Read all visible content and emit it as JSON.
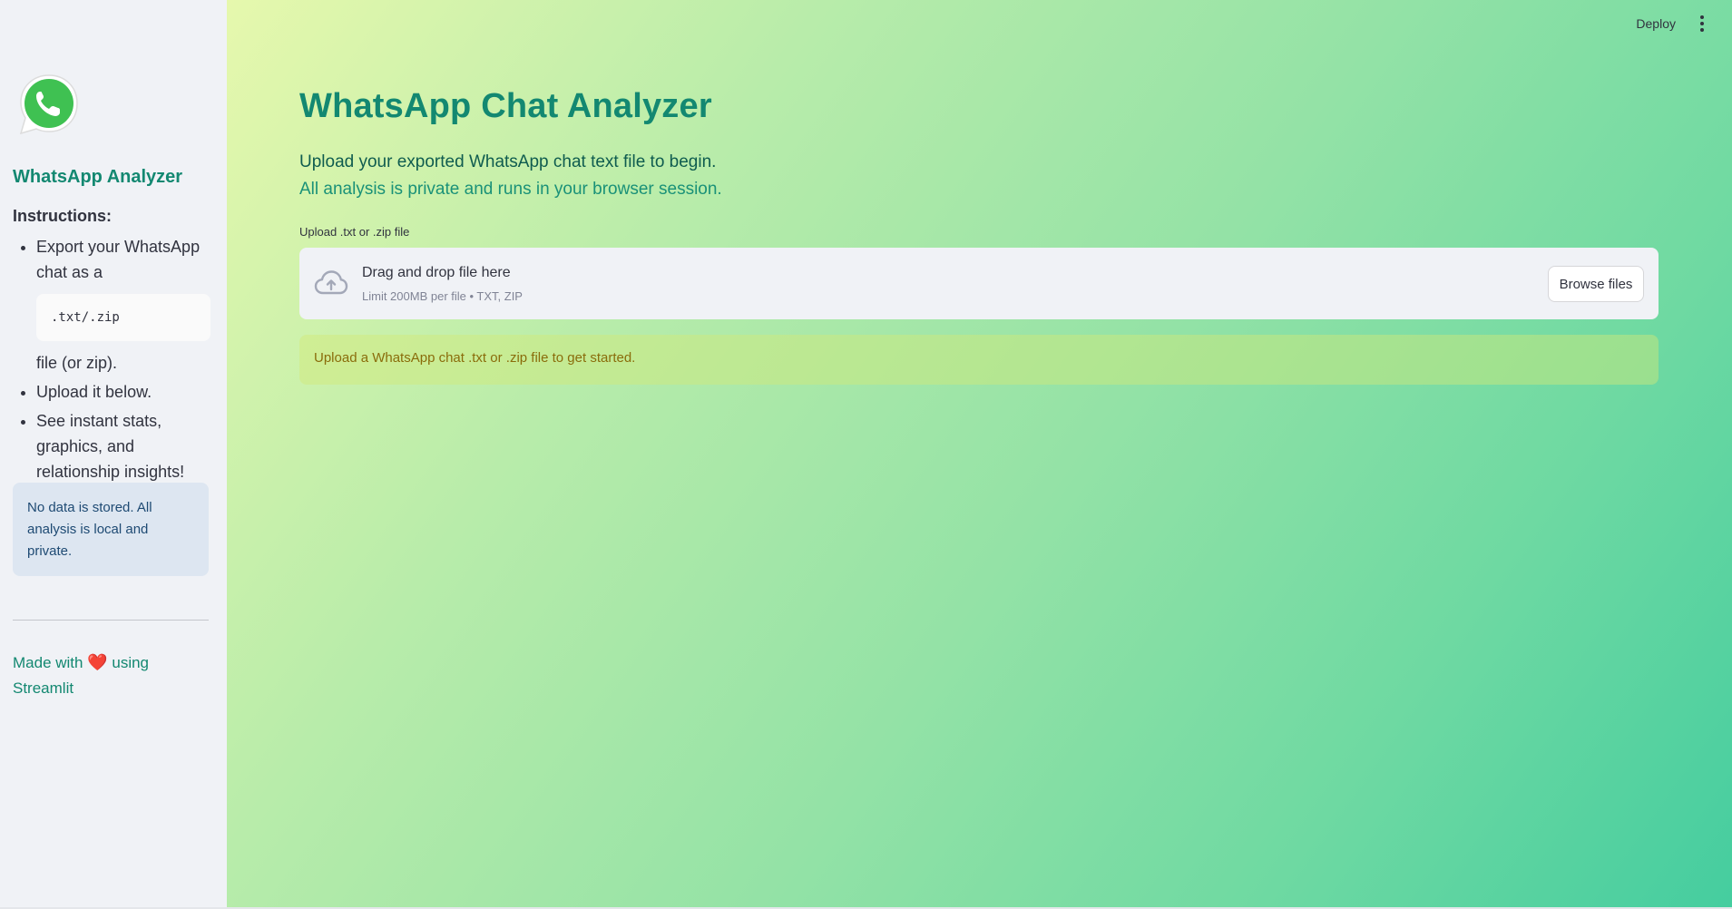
{
  "sidebar": {
    "logo": "whatsapp-logo",
    "title": "WhatsApp Analyzer",
    "instructions_heading": "Instructions:",
    "instructions": {
      "item1_before": "Export your WhatsApp chat as a",
      "item1_code": ".txt/.zip",
      "item1_after": "file (or zip).",
      "item2": "Upload it below.",
      "item3": "See instant stats, graphics, and relationship insights!"
    },
    "privacy_note": "No data is stored. All analysis is local and private.",
    "footer": {
      "made_with": "Made with",
      "heart": "❤️",
      "using": "using Streamlit"
    }
  },
  "toolbar": {
    "deploy_label": "Deploy",
    "menu_icon": "kebab-menu-icon"
  },
  "main": {
    "title": "WhatsApp Chat Analyzer",
    "subtitle": "Upload your exported WhatsApp chat text file to begin.",
    "subtitle_privacy": "All analysis is private and runs in your browser session.",
    "uploader": {
      "label": "Upload .txt or .zip file",
      "drag_text": "Drag and drop file here",
      "limit_text": "Limit 200MB per file • TXT, ZIP",
      "browse_label": "Browse files",
      "icon": "cloud-upload-icon"
    },
    "info_message": "Upload a WhatsApp chat .txt or .zip file to get started."
  },
  "colors": {
    "accent": "#138871",
    "sidebar_bg": "#f0f2f6",
    "info_text": "#8a6c0b",
    "privacy_box_bg": "#dde6f1"
  }
}
